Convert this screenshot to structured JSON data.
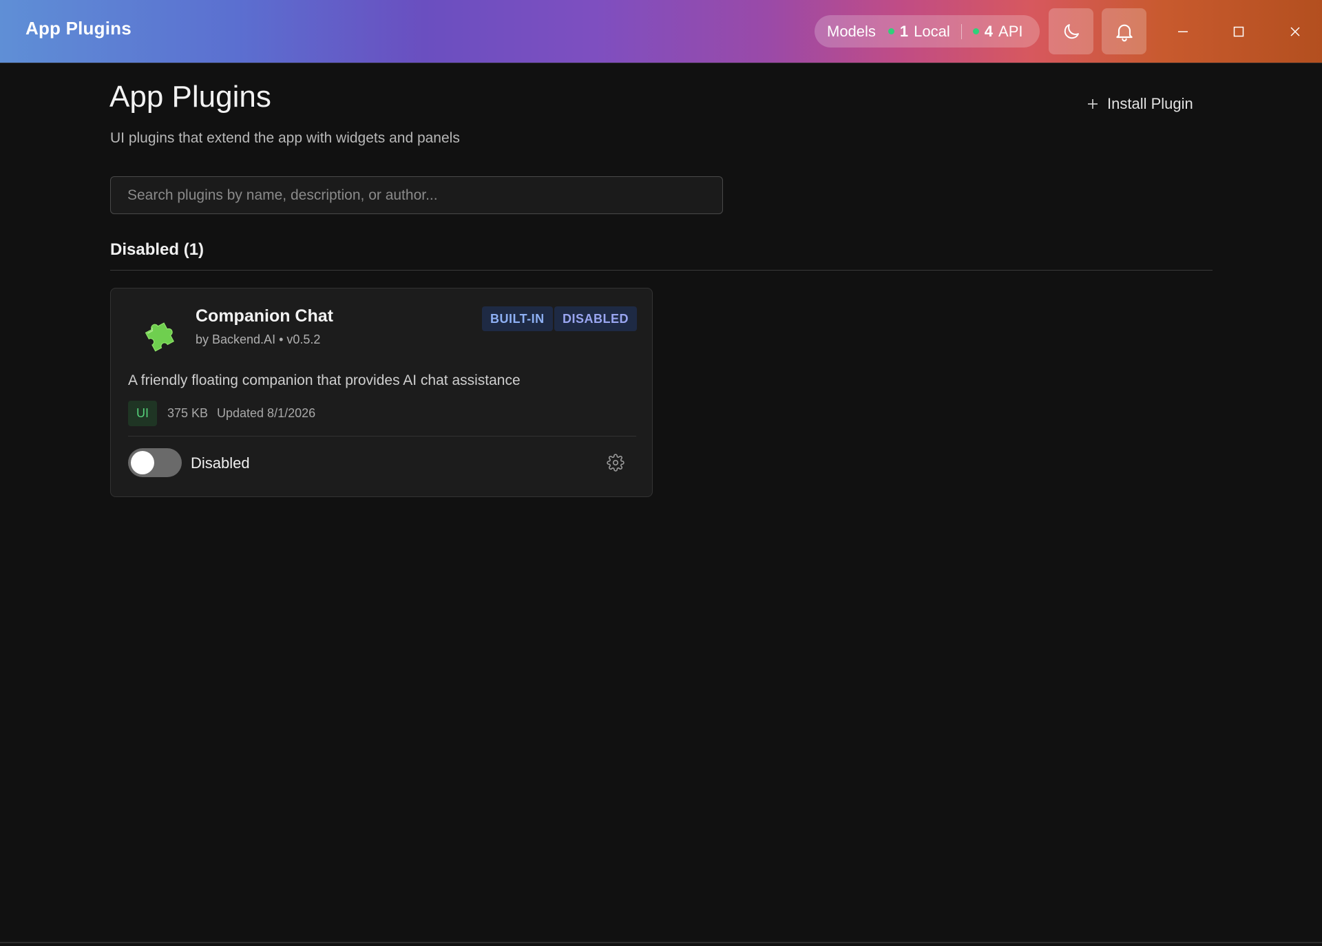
{
  "window": {
    "title": "App Plugins",
    "models": {
      "label": "Models",
      "local_count": "1",
      "local_label": "Local",
      "api_count": "4",
      "api_label": "API",
      "status_color": "#2fd07a"
    },
    "icons": [
      "moon-icon",
      "bell-icon",
      "minimize-icon",
      "maximize-icon",
      "close-icon"
    ]
  },
  "header": {
    "title": "App Plugins",
    "subtitle": "UI plugins that extend the app with widgets and panels",
    "install_label": "Install Plugin"
  },
  "search": {
    "placeholder": "Search plugins by name, description, or author...",
    "value": ""
  },
  "section": {
    "title": "Disabled (1)"
  },
  "plugins": [
    {
      "name": "Companion Chat",
      "meta": "by Backend.AI • v0.5.2",
      "badges": [
        "BUILT-IN",
        "DISABLED"
      ],
      "description": "A friendly floating companion that provides AI chat assistance",
      "type_tag": "UI",
      "size": "375 KB",
      "updated": "Updated 8/1/2026",
      "enabled": false,
      "toggle_label": "Disabled",
      "icon": "puzzle-icon"
    }
  ],
  "colors": {
    "background": "#111111",
    "card": "#1c1c1c",
    "badge_bg": "#1e2a44",
    "badge_text": "#8eb0f4",
    "tag_ui_bg": "#1f3524",
    "tag_ui_text": "#55d07a",
    "puzzle_green": "#6fcf4f"
  }
}
